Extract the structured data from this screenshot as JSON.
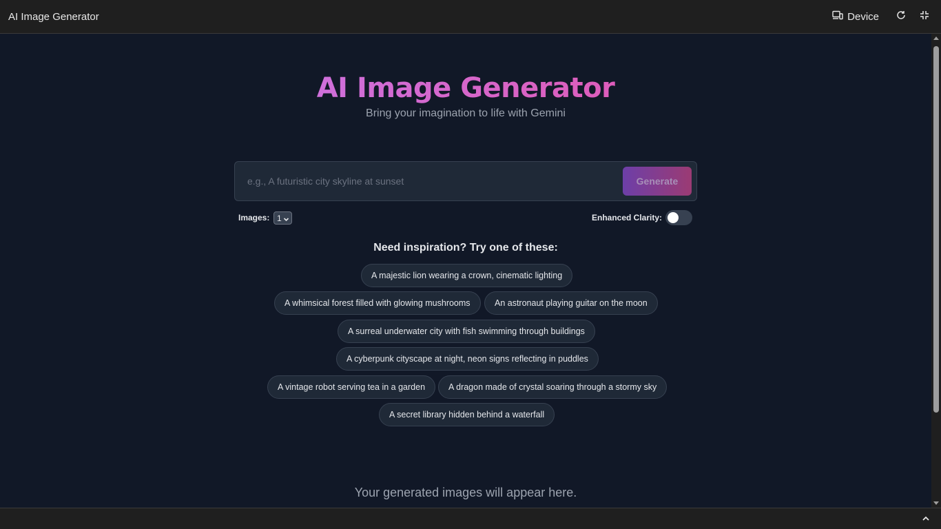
{
  "topbar": {
    "title": "AI Image Generator",
    "device_label": "Device",
    "icons": [
      "device-icon",
      "refresh-icon",
      "collapse-icon"
    ]
  },
  "hero": {
    "title": "AI Image Generator",
    "subtitle": "Bring your imagination to life with Gemini"
  },
  "prompt": {
    "value": "",
    "placeholder": "e.g., A futuristic city skyline at sunset",
    "generate_label": "Generate"
  },
  "options": {
    "images_label": "Images:",
    "images_value": "1",
    "clarity_label": "Enhanced Clarity:",
    "clarity_enabled": false
  },
  "inspiration": {
    "title": "Need inspiration? Try one of these:",
    "chips": [
      "A majestic lion wearing a crown, cinematic lighting",
      "A whimsical forest filled with glowing mushrooms",
      "An astronaut playing guitar on the moon",
      "A surreal underwater city with fish swimming through buildings",
      "A cyberpunk cityscape at night, neon signs reflecting in puddles",
      "A vintage robot serving tea in a garden",
      "A dragon made of crystal soaring through a stormy sky",
      "A secret library hidden behind a waterfall"
    ]
  },
  "results": {
    "empty_text": "Your generated images will appear here."
  },
  "colors": {
    "background": "#111827",
    "accent_start": "#c084fc",
    "accent_end": "#ec4899"
  }
}
